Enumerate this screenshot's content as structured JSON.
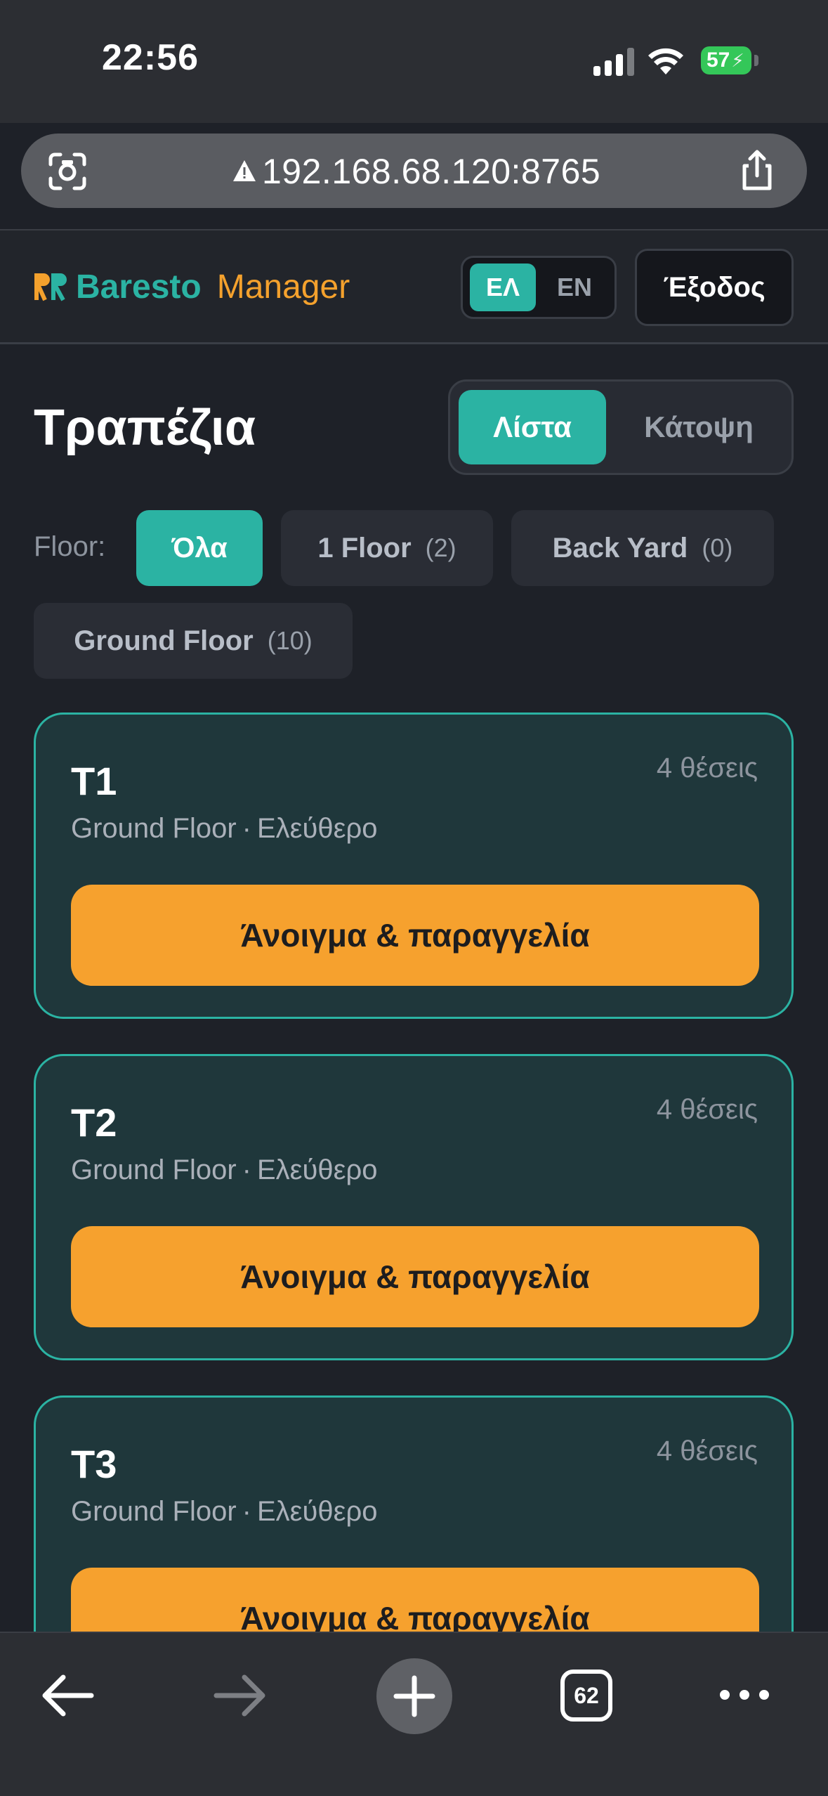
{
  "status_bar": {
    "time": "22:56",
    "battery": "57"
  },
  "browser": {
    "url": "192.168.68.120:8765",
    "tab_count": "62"
  },
  "header": {
    "brand_name": "Baresto",
    "brand_suffix": "Manager",
    "lang_el": "ΕΛ",
    "lang_en": "EN",
    "active_lang": "ΕΛ",
    "logout": "Έξοδος"
  },
  "page": {
    "title": "Τραπέζια",
    "view_list": "Λίστα",
    "view_plan": "Κάτοψη",
    "active_view": "Λίστα"
  },
  "filters": {
    "label": "Floor:",
    "chips": [
      {
        "name": "Όλα",
        "count": ""
      },
      {
        "name": "1 Floor",
        "count": "(2)"
      },
      {
        "name": "Back Yard",
        "count": "(0)"
      },
      {
        "name": "Ground Floor",
        "count": "(10)"
      }
    ],
    "active": "Όλα"
  },
  "tables": [
    {
      "name": "T1",
      "seats": "4 θέσεις",
      "floor": "Ground Floor",
      "status": "Ελεύθερο",
      "action": "Άνοιγμα & παραγγελία"
    },
    {
      "name": "T2",
      "seats": "4 θέσεις",
      "floor": "Ground Floor",
      "status": "Ελεύθερο",
      "action": "Άνοιγμα & παραγγελία"
    },
    {
      "name": "T3",
      "seats": "4 θέσεις",
      "floor": "Ground Floor",
      "status": "Ελεύθερο",
      "action": "Άνοιγμα & παραγγελία"
    }
  ],
  "colors": {
    "accent": "#2bb3a3",
    "action": "#f6a12e",
    "background": "#1e2128",
    "card": "#1f373b"
  }
}
